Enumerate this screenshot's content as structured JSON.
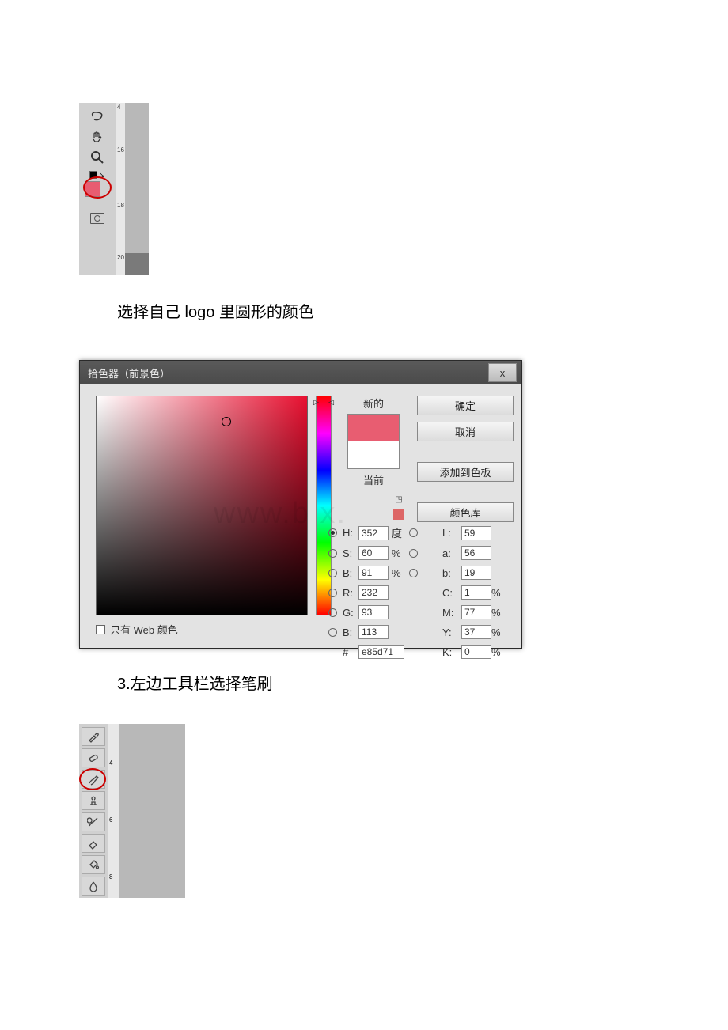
{
  "toolbar1": {
    "tools": [
      "lasso",
      "hand",
      "zoom",
      "swap-colors",
      "quickmask"
    ],
    "ruler_marks": [
      "4",
      "16",
      "18",
      "20"
    ],
    "fg_color": "#e85d71"
  },
  "caption1": "选择自己 logo 里圆形的颜色",
  "picker": {
    "title": "拾色器（前景色）",
    "close": "x",
    "new_label": "新的",
    "current_label": "当前",
    "buttons": {
      "ok": "确定",
      "cancel": "取消",
      "add": "添加到色板",
      "lib": "颜色库"
    },
    "hsb": {
      "H": "352",
      "S": "60",
      "B": "91",
      "deg": "度",
      "pct": "%"
    },
    "lab": {
      "L": "59",
      "a": "56",
      "b": "19"
    },
    "rgb": {
      "R": "232",
      "G": "93",
      "B": "113"
    },
    "cmyk": {
      "C": "1",
      "M": "77",
      "Y": "37",
      "K": "0",
      "pct": "%"
    },
    "hex_label": "#",
    "hex": "e85d71",
    "web_only": "只有 Web 颜色",
    "labels": {
      "H": "H:",
      "S": "S:",
      "Bb": "B:",
      "L": "L:",
      "a": "a:",
      "b": "b:",
      "R": "R:",
      "G": "G:",
      "Bv": "B:",
      "C": "C:",
      "M": "M:",
      "Y": "Y:",
      "K": "K:"
    }
  },
  "caption2": "3.左边工具栏选择笔刷",
  "toolbar2": {
    "tools": [
      "eyedropper",
      "heal",
      "brush",
      "stamp",
      "history-brush",
      "eraser",
      "bucket",
      "blur"
    ],
    "ruler_marks": [
      "4",
      "6",
      "8"
    ]
  },
  "watermark": "www.b     x."
}
